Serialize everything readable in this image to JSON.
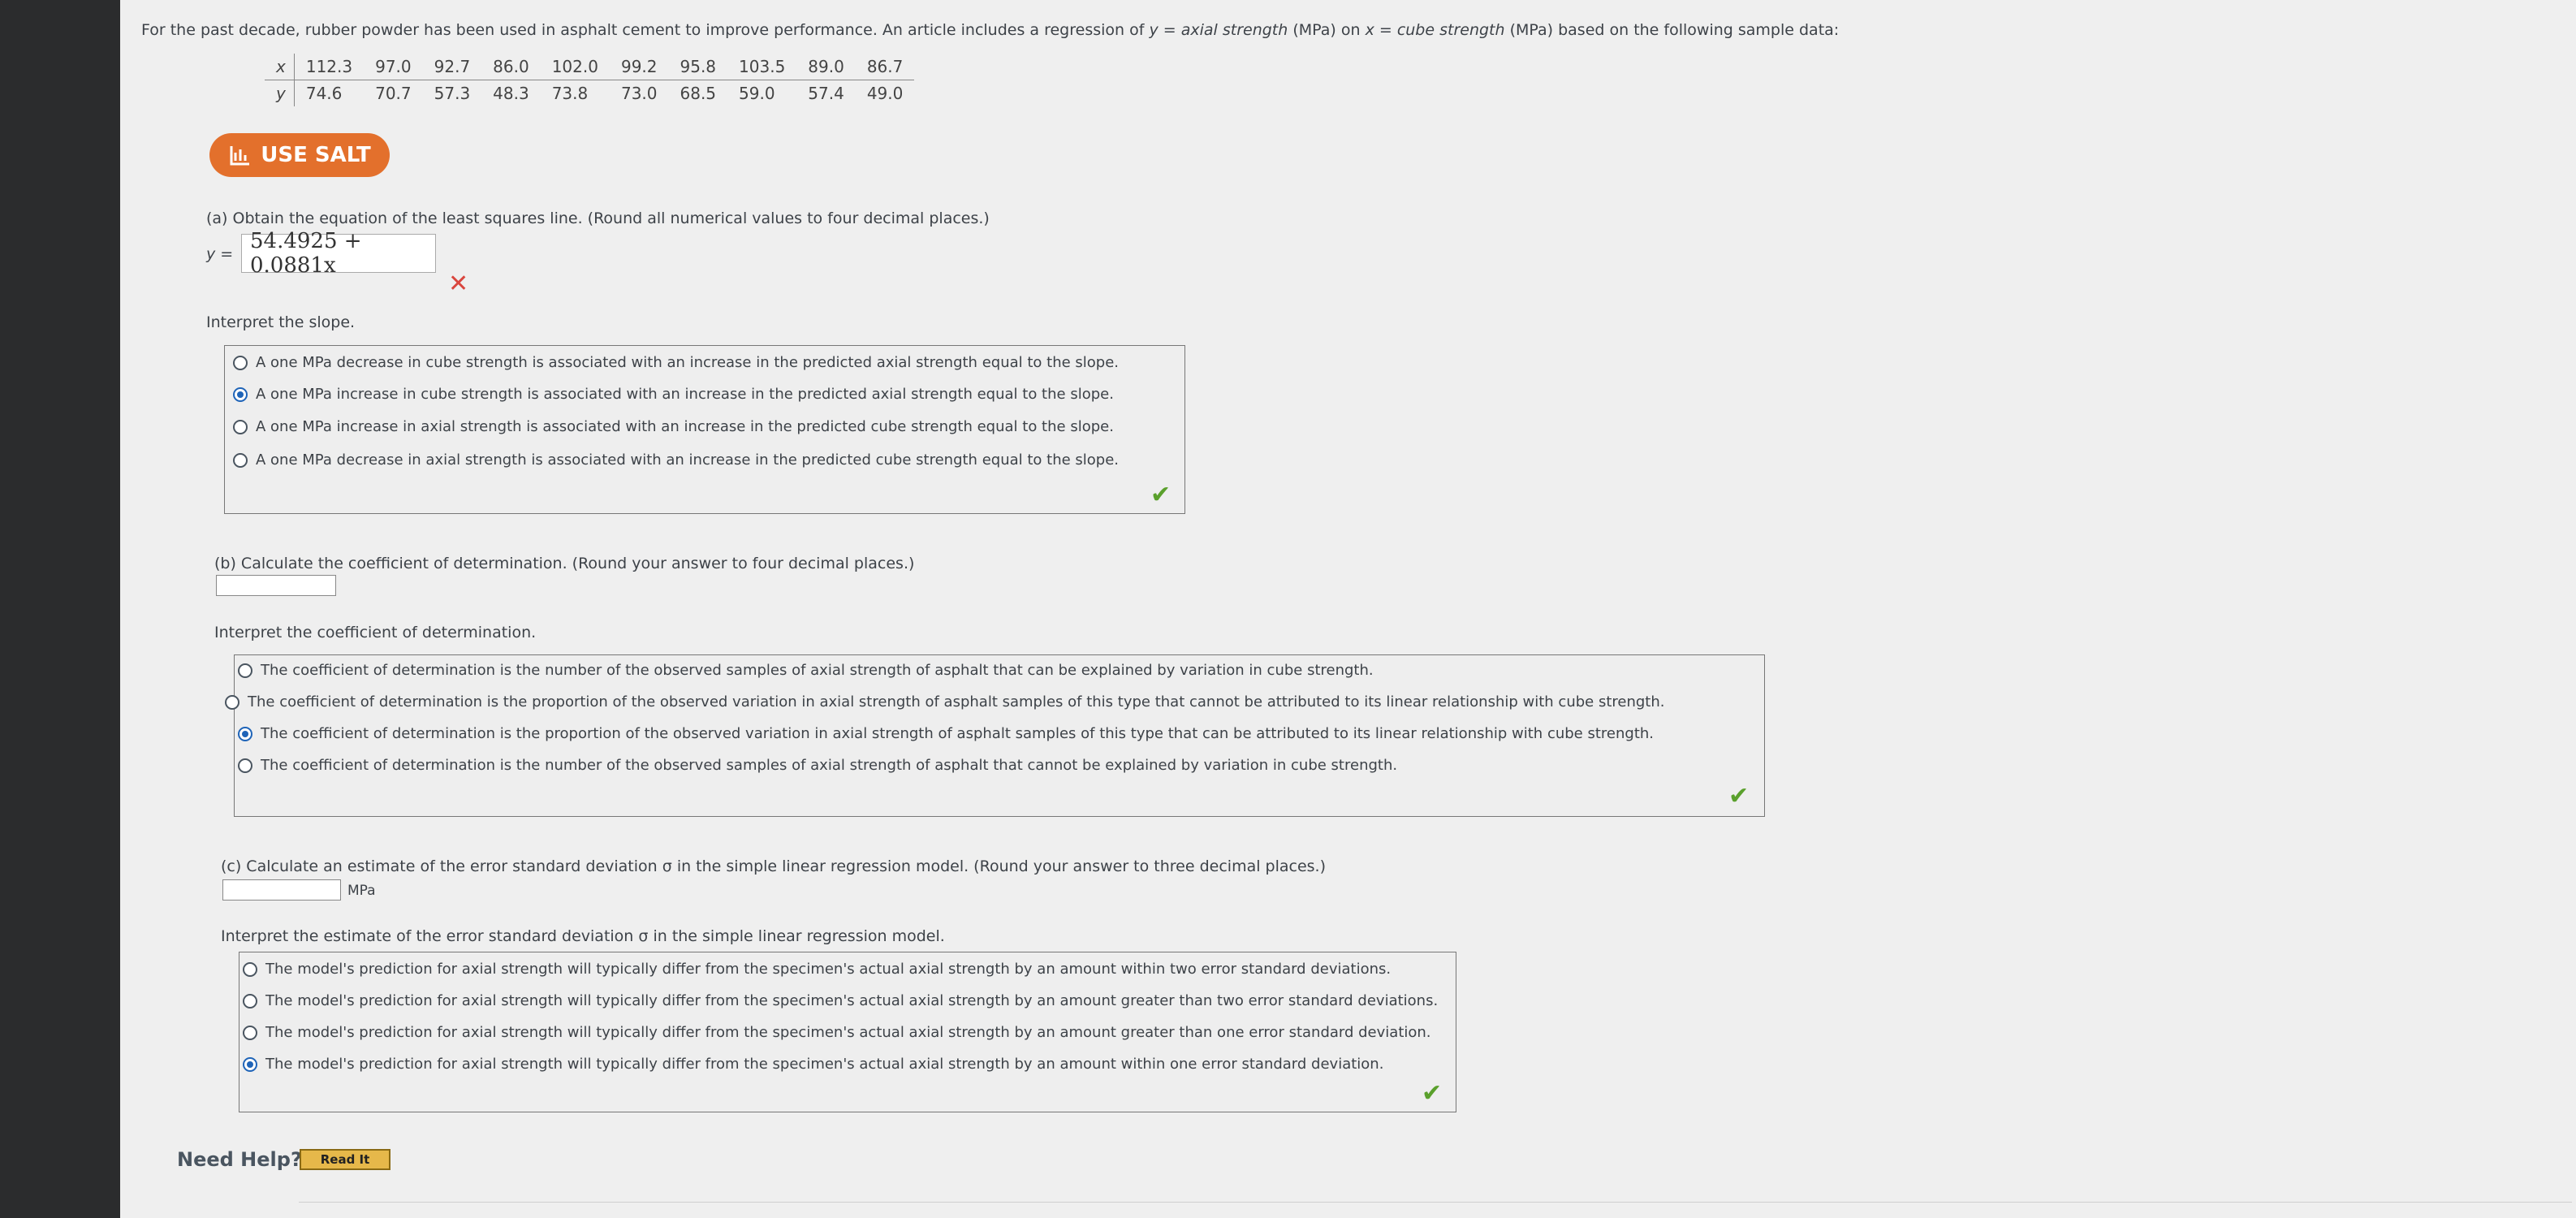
{
  "problem": {
    "intro_pre": "For the past decade, rubber powder has been used in asphalt cement to improve performance. An article includes a regression of ",
    "y_var": "y",
    "eq1": " = ",
    "y_desc": "axial strength",
    "mid": " (MPa) on ",
    "x_var": "x",
    "eq2": " = ",
    "x_desc": "cube strength",
    "intro_post": " (MPa) based on the following sample data:"
  },
  "table": {
    "x_label": "x",
    "y_label": "y",
    "x_values": [
      "112.3",
      "97.0",
      "92.7",
      "86.0",
      "102.0",
      "99.2",
      "95.8",
      "103.5",
      "89.0",
      "86.7"
    ],
    "y_values": [
      "74.6",
      "70.7",
      "57.3",
      "48.3",
      "73.8",
      "73.0",
      "68.5",
      "59.0",
      "57.4",
      "49.0"
    ]
  },
  "salt_button": {
    "label": "USE SALT"
  },
  "part_a": {
    "prompt": "(a) Obtain the equation of the least squares line. (Round all numerical values to four decimal places.)",
    "y_label": "y =",
    "answer": "54.4925 + 0.0881x",
    "interpret_prompt": "Interpret the slope.",
    "options": [
      "A one MPa decrease in cube strength is associated with an increase in the predicted axial strength equal to the slope.",
      "A one MPa increase in cube strength is associated with an increase in the predicted axial strength equal to the slope.",
      "A one MPa increase in axial strength is associated with an increase in the predicted cube strength equal to the slope.",
      "A one MPa decrease in axial strength is associated with an increase in the predicted cube strength equal to the slope."
    ],
    "selected_index": 1
  },
  "part_b": {
    "prompt": "(b) Calculate the coefficient of determination. (Round your answer to four decimal places.)",
    "interpret_prompt": "Interpret the coefficient of determination.",
    "options": [
      "The coefficient of determination is the number of the observed samples of axial strength of asphalt that can be explained by variation in cube strength.",
      "The coefficient of determination is the proportion of the observed variation in axial strength of asphalt samples of this type that cannot be attributed to its linear relationship with cube strength.",
      "The coefficient of determination is the proportion of the observed variation in axial strength of asphalt samples of this type that can be attributed to its linear relationship with cube strength.",
      "The coefficient of determination is the number of the observed samples of axial strength of asphalt that cannot be explained by variation in cube strength."
    ],
    "selected_index": 2
  },
  "part_c": {
    "prompt": "(c) Calculate an estimate of the error standard deviation σ in the simple linear regression model. (Round your answer to three decimal places.)",
    "unit": "MPa",
    "interpret_prompt": "Interpret the estimate of the error standard deviation σ in the simple linear regression model.",
    "options": [
      "The model's prediction for axial strength will typically differ from the specimen's actual axial strength by an amount within two error standard deviations.",
      "The model's prediction for axial strength will typically differ from the specimen's actual axial strength by an amount greater than two error standard deviations.",
      "The model's prediction for axial strength will typically differ from the specimen's actual axial strength by an amount greater than one error standard deviation.",
      "The model's prediction for axial strength will typically differ from the specimen's actual axial strength by an amount within one error standard deviation."
    ],
    "selected_index": 3
  },
  "help": {
    "label": "Need Help?",
    "read_it": "Read It"
  },
  "colors": {
    "accent": "#e3702c",
    "correct": "#5aa02c",
    "incorrect": "#d9463e",
    "radio": "#1f64b8"
  }
}
